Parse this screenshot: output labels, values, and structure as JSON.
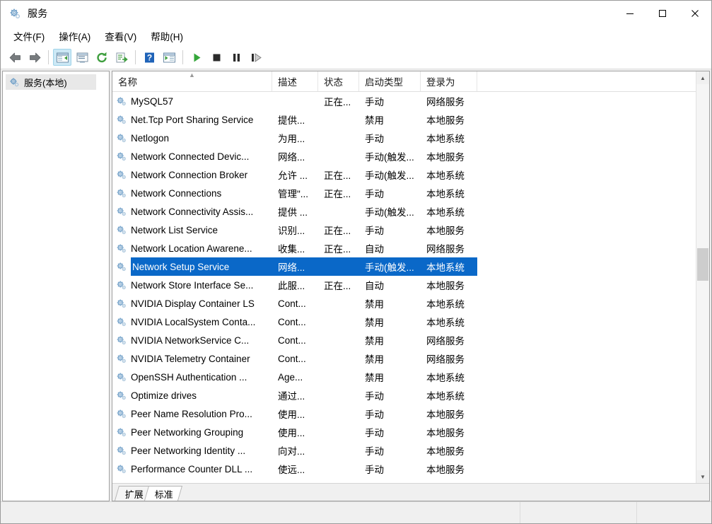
{
  "window": {
    "title": "服务",
    "title_icon": "services-gear-icon",
    "caption": {
      "minimize": "minimize-icon",
      "maximize": "maximize-icon",
      "close": "close-icon"
    }
  },
  "menubar": {
    "items": [
      {
        "label": "文件(F)",
        "name": "menu-file"
      },
      {
        "label": "操作(A)",
        "name": "menu-action"
      },
      {
        "label": "查看(V)",
        "name": "menu-view"
      },
      {
        "label": "帮助(H)",
        "name": "menu-help"
      }
    ]
  },
  "toolbar": {
    "buttons": [
      {
        "name": "back-icon",
        "glyph": "back-arrow"
      },
      {
        "name": "forward-icon",
        "glyph": "forward-arrow"
      },
      {
        "name": "separator",
        "glyph": "sep"
      },
      {
        "name": "show-hide-console-tree-icon",
        "glyph": "tree-pane",
        "pressed": true
      },
      {
        "name": "properties-icon",
        "glyph": "properties"
      },
      {
        "name": "refresh-icon",
        "glyph": "refresh"
      },
      {
        "name": "export-list-icon",
        "glyph": "export"
      },
      {
        "name": "separator",
        "glyph": "sep"
      },
      {
        "name": "help-icon",
        "glyph": "help"
      },
      {
        "name": "show-hide-action-pane-icon",
        "glyph": "action-pane"
      },
      {
        "name": "separator",
        "glyph": "sep"
      },
      {
        "name": "start-service-icon",
        "glyph": "play"
      },
      {
        "name": "stop-service-icon",
        "glyph": "stop"
      },
      {
        "name": "pause-service-icon",
        "glyph": "pause"
      },
      {
        "name": "restart-service-icon",
        "glyph": "restart"
      }
    ]
  },
  "sidebar": {
    "nodes": [
      {
        "label": "服务(本地)",
        "name": "sidebar-item-services-local",
        "icon": "services-gear-icon",
        "selected": true
      }
    ]
  },
  "list": {
    "columns": [
      {
        "label": "名称",
        "name": "column-header-name",
        "sorted": true
      },
      {
        "label": "描述",
        "name": "column-header-description"
      },
      {
        "label": "状态",
        "name": "column-header-status"
      },
      {
        "label": "启动类型",
        "name": "column-header-startup-type"
      },
      {
        "label": "登录为",
        "name": "column-header-log-on-as"
      }
    ],
    "rows": [
      {
        "name": "MySQL57",
        "desc": "",
        "status": "正在...",
        "startup": "手动",
        "logon": "网络服务",
        "selected": false
      },
      {
        "name": "Net.Tcp Port Sharing Service",
        "desc": "提供...",
        "status": "",
        "startup": "禁用",
        "logon": "本地服务",
        "selected": false
      },
      {
        "name": "Netlogon",
        "desc": "为用...",
        "status": "",
        "startup": "手动",
        "logon": "本地系统",
        "selected": false
      },
      {
        "name": "Network Connected Devic...",
        "desc": "网络...",
        "status": "",
        "startup": "手动(触发...",
        "logon": "本地服务",
        "selected": false
      },
      {
        "name": "Network Connection Broker",
        "desc": "允许 ...",
        "status": "正在...",
        "startup": "手动(触发...",
        "logon": "本地系统",
        "selected": false
      },
      {
        "name": "Network Connections",
        "desc": "管理\"...",
        "status": "正在...",
        "startup": "手动",
        "logon": "本地系统",
        "selected": false
      },
      {
        "name": "Network Connectivity Assis...",
        "desc": "提供 ...",
        "status": "",
        "startup": "手动(触发...",
        "logon": "本地系统",
        "selected": false
      },
      {
        "name": "Network List Service",
        "desc": "识别...",
        "status": "正在...",
        "startup": "手动",
        "logon": "本地服务",
        "selected": false
      },
      {
        "name": "Network Location Awarene...",
        "desc": "收集...",
        "status": "正在...",
        "startup": "自动",
        "logon": "网络服务",
        "selected": false
      },
      {
        "name": "Network Setup Service",
        "desc": "网络...",
        "status": "",
        "startup": "手动(触发...",
        "logon": "本地系统",
        "selected": true
      },
      {
        "name": "Network Store Interface Se...",
        "desc": "此服...",
        "status": "正在...",
        "startup": "自动",
        "logon": "本地服务",
        "selected": false
      },
      {
        "name": "NVIDIA Display Container LS",
        "desc": "Cont...",
        "status": "",
        "startup": "禁用",
        "logon": "本地系统",
        "selected": false
      },
      {
        "name": "NVIDIA LocalSystem Conta...",
        "desc": "Cont...",
        "status": "",
        "startup": "禁用",
        "logon": "本地系统",
        "selected": false
      },
      {
        "name": "NVIDIA NetworkService C...",
        "desc": "Cont...",
        "status": "",
        "startup": "禁用",
        "logon": "网络服务",
        "selected": false
      },
      {
        "name": "NVIDIA Telemetry Container",
        "desc": "Cont...",
        "status": "",
        "startup": "禁用",
        "logon": "网络服务",
        "selected": false
      },
      {
        "name": "OpenSSH Authentication ...",
        "desc": "Age...",
        "status": "",
        "startup": "禁用",
        "logon": "本地系统",
        "selected": false
      },
      {
        "name": "Optimize drives",
        "desc": "通过...",
        "status": "",
        "startup": "手动",
        "logon": "本地系统",
        "selected": false
      },
      {
        "name": "Peer Name Resolution Pro...",
        "desc": "使用...",
        "status": "",
        "startup": "手动",
        "logon": "本地服务",
        "selected": false
      },
      {
        "name": "Peer Networking Grouping",
        "desc": "使用...",
        "status": "",
        "startup": "手动",
        "logon": "本地服务",
        "selected": false
      },
      {
        "name": "Peer Networking Identity ...",
        "desc": "向对...",
        "status": "",
        "startup": "手动",
        "logon": "本地服务",
        "selected": false
      },
      {
        "name": "Performance Counter DLL ...",
        "desc": "使远...",
        "status": "",
        "startup": "手动",
        "logon": "本地服务",
        "selected": false
      }
    ]
  },
  "tabs": [
    {
      "label": "扩展",
      "name": "tab-extended",
      "active": false
    },
    {
      "label": "标准",
      "name": "tab-standard",
      "active": true
    }
  ],
  "statusbar": {
    "segment1": "",
    "segment2": "",
    "segment3": ""
  },
  "colors": {
    "selection": "#0a68c8",
    "toolbar_pressed": "#cce8f5",
    "window_chrome": "#f0f0f0"
  }
}
